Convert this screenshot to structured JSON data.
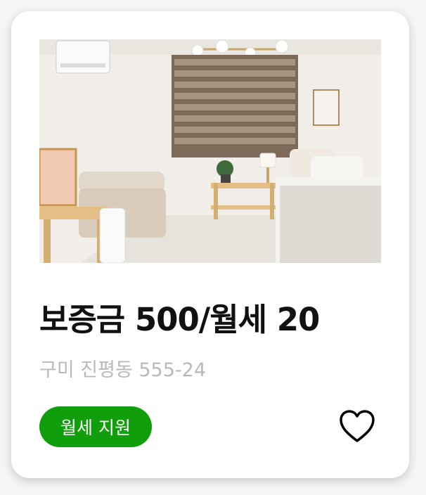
{
  "listing": {
    "image_alt": "room-photo",
    "price_text": "보증금 500/월세 20",
    "address": "구미 진평동 555-24",
    "badge_label": "월세 지원",
    "favorite_icon": "heart-outline-icon"
  },
  "colors": {
    "badge_bg": "#119e0c",
    "address_text": "#b9b9b9",
    "card_bg": "#ffffff"
  }
}
